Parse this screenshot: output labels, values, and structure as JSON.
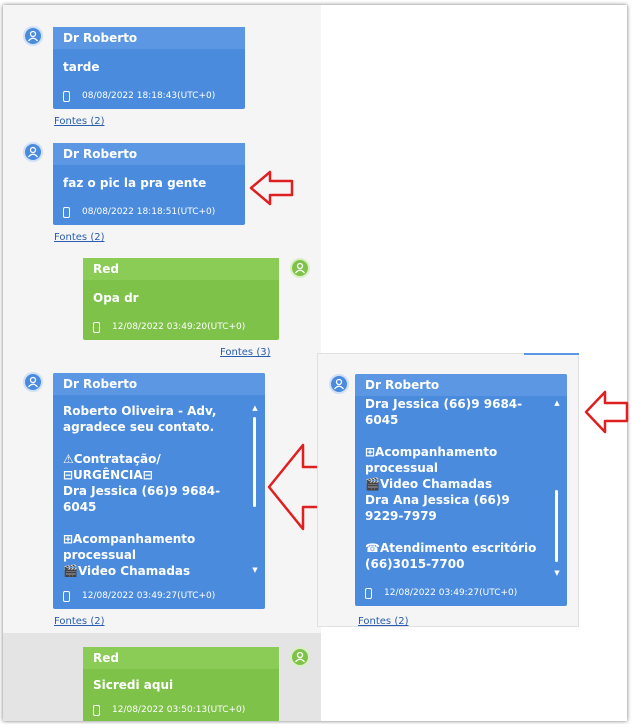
{
  "messages": [
    {
      "sender": "Dr Roberto",
      "text": "tarde",
      "timestamp": "08/08/2022 18:18:43(UTC+0)",
      "fontes": "Fontes (2)"
    },
    {
      "sender": "Dr Roberto",
      "text": "faz o pic la pra gente",
      "timestamp": "08/08/2022 18:18:51(UTC+0)",
      "fontes": "Fontes (2)"
    },
    {
      "sender": "Red",
      "text": "Opa dr",
      "timestamp": "12/08/2022 03:49:20(UTC+0)",
      "fontes": "Fontes (3)"
    },
    {
      "sender": "Dr Roberto",
      "lines": [
        "Roberto Oliveira - Adv,",
        "agradece seu contato.",
        "",
        "⚠Contratação/",
        "⊟URGÊNCIA⊟",
        "Dra Jessica (66)9 9684-6045",
        "",
        "⊞Acompanhamento",
        "processual",
        "🎬Video Chamadas"
      ],
      "timestamp": "12/08/2022 03:49:27(UTC+0)",
      "fontes": "Fontes (2)"
    },
    {
      "sender": "Red",
      "text": "Sicredi aqui",
      "timestamp": "12/08/2022 03:50:13(UTC+0)"
    }
  ],
  "zoom_message": {
    "sender": "Dr Roberto",
    "lines": [
      "Dra Jessica (66)9 9684-6045",
      "",
      "⊞Acompanhamento",
      "processual",
      "🎬Video Chamadas",
      "Dra Ana Jessica (66)9",
      "9229-7979",
      "",
      "☎Atendimento escritório",
      "(66)3015-7700"
    ],
    "timestamp": "12/08/2022 03:49:27(UTC+0)",
    "fontes": "Fontes (2)"
  },
  "colors": {
    "blue_bubble": "#4a8bde",
    "green_bubble": "#7fc24a",
    "arrow": "#e02020",
    "link": "#2a5db0"
  }
}
